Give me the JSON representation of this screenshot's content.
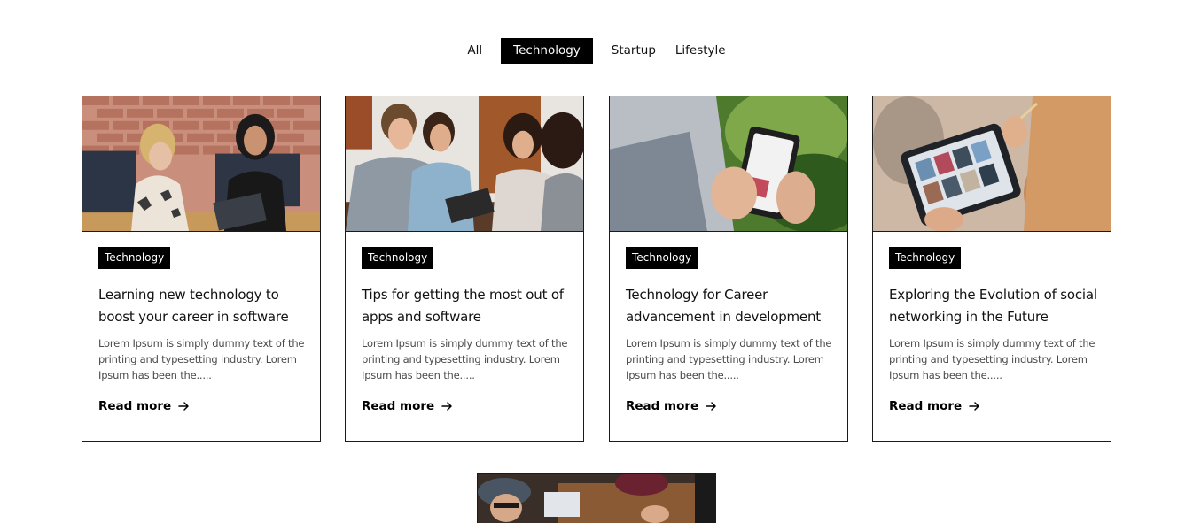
{
  "filters": [
    {
      "label": "All",
      "active": false
    },
    {
      "label": "Technology",
      "active": true
    },
    {
      "label": "Startup",
      "active": false
    },
    {
      "label": "Lifestyle",
      "active": false
    }
  ],
  "cards": [
    {
      "tag": "Technology",
      "title": "Learning new technology to boost your career in software",
      "excerpt": "Lorem Ipsum is simply dummy text of the printing and typesetting industry. Lorem Ipsum has been the.....",
      "read_more": "Read more",
      "image": "office-meeting-photo"
    },
    {
      "tag": "Technology",
      "title": "Tips for getting the most out of apps and software",
      "excerpt": "Lorem Ipsum is simply dummy text of the printing and typesetting industry. Lorem Ipsum has been the.....",
      "read_more": "Read more",
      "image": "group-cafe-photo"
    },
    {
      "tag": "Technology",
      "title": "Technology for Career advancement in development",
      "excerpt": "Lorem Ipsum is simply dummy text of the printing and typesetting industry. Lorem Ipsum has been the.....",
      "read_more": "Read more",
      "image": "smartphone-hands-photo"
    },
    {
      "tag": "Technology",
      "title": "Exploring the Evolution of social networking in the Future",
      "excerpt": "Lorem Ipsum is simply dummy text of the printing and typesetting industry. Lorem Ipsum has been the.....",
      "read_more": "Read more",
      "image": "tablet-stylus-photo"
    }
  ],
  "icons": {
    "read_more": "arrow-right-icon"
  },
  "colors": {
    "accent": "#000000",
    "border": "#1a1a1a",
    "text": "#111111",
    "muted": "#4a4a4a"
  }
}
